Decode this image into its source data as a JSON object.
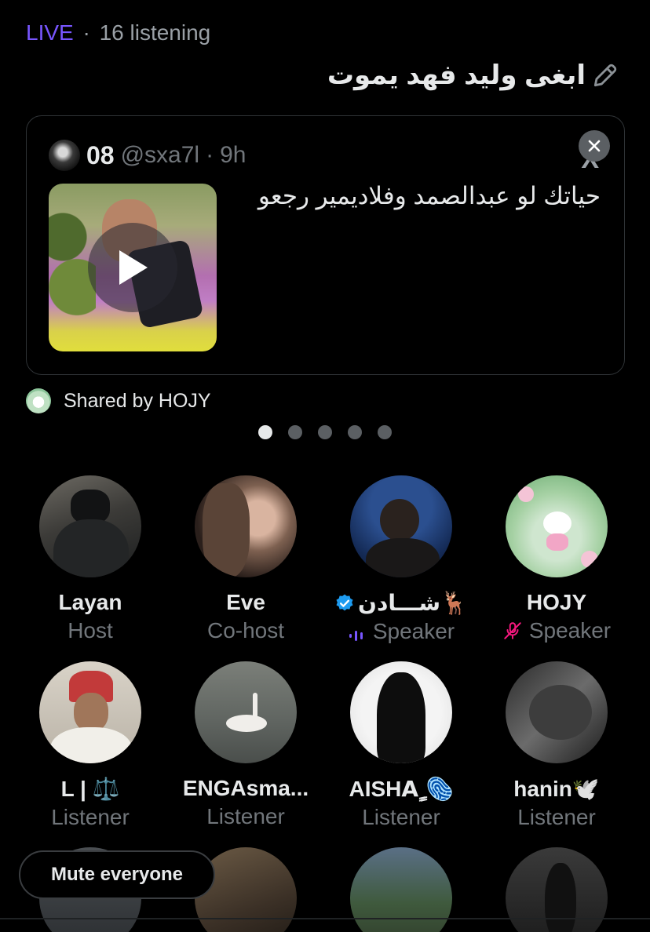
{
  "status": {
    "live": "LIVE",
    "separator": "·",
    "listening": "16 listening"
  },
  "space_title": "ابغى وليد فهد يموت",
  "shared_post": {
    "author_name": "08",
    "handle": "@sxa7l",
    "separator": "·",
    "time": "9h",
    "text": "حياتك لو عبدالصمد وفلاديمير رجعو",
    "platform_logo": "X"
  },
  "shared_by": "Shared by HOJY",
  "pager": {
    "total": 5,
    "active_index": 0
  },
  "participants": [
    {
      "name": "Layan",
      "role": "Host"
    },
    {
      "name": "Eve",
      "role": "Co-host"
    },
    {
      "name": "شـــادن🦌",
      "role": "Speaker",
      "verified": true,
      "status_icon": "speaking-icon"
    },
    {
      "name": "HOJY",
      "role": "Speaker",
      "status_icon": "mic-off-icon"
    },
    {
      "name": "L | ⚖️",
      "role": "Listener"
    },
    {
      "name": "ENGAsma...",
      "role": "Listener"
    },
    {
      "name": "AISHAٍ ٍ🫆",
      "role": "Listener"
    },
    {
      "name": "hanin🕊️",
      "role": "Listener"
    }
  ],
  "mute_button": "Mute everyone",
  "colors": {
    "live": "#7856ff",
    "verified": "#1d9bf0",
    "mic_off": "#f91880",
    "speaking": "#7856ff"
  }
}
